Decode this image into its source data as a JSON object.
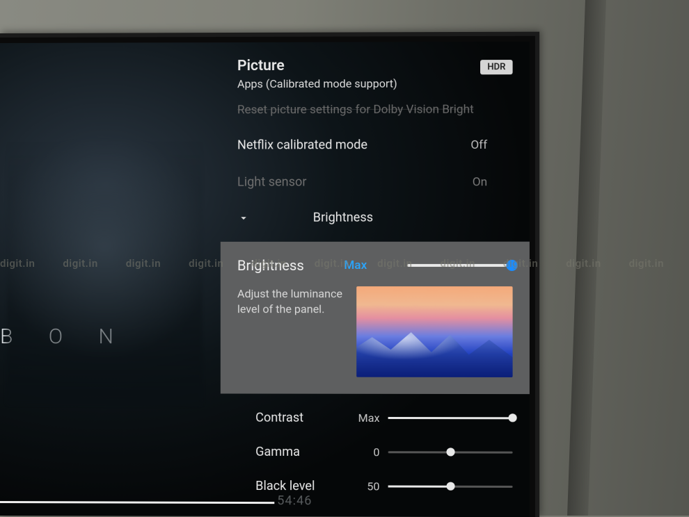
{
  "watermark_text": "digit.in",
  "video": {
    "title_fragment": "B O N",
    "timecode": "54:46"
  },
  "panel": {
    "title": "Picture",
    "subtitle": "Apps (Calibrated mode support)",
    "hdr_badge": "HDR",
    "truncated_row": "Reset picture settings for Dolby Vision Bright",
    "rows": {
      "netflix": {
        "label": "Netflix calibrated mode",
        "value": "Off"
      },
      "light_sensor": {
        "label": "Light sensor",
        "value": "On"
      }
    },
    "section": {
      "label": "Brightness"
    },
    "highlight": {
      "title": "Brightness",
      "value": "Max",
      "description": "Adjust the luminance level of the panel."
    },
    "sliders": {
      "contrast": {
        "label": "Contrast",
        "value": "Max",
        "percent": 100
      },
      "gamma": {
        "label": "Gamma",
        "value": "0",
        "percent": 50
      },
      "black_level": {
        "label": "Black level",
        "value": "50",
        "percent": 50
      }
    }
  }
}
